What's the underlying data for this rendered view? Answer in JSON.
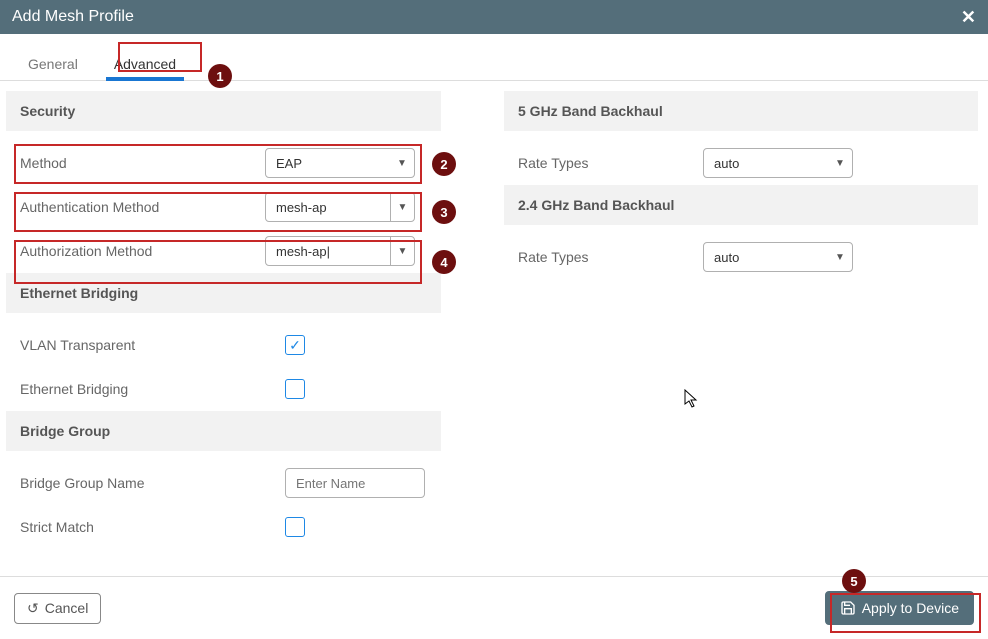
{
  "titlebar": {
    "title": "Add Mesh Profile"
  },
  "tabs": {
    "general": "General",
    "advanced": "Advanced"
  },
  "security": {
    "heading": "Security",
    "method_label": "Method",
    "method_value": "EAP",
    "auth_label": "Authentication Method",
    "auth_value": "mesh-ap",
    "authz_label": "Authorization Method",
    "authz_value": "mesh-ap|"
  },
  "ethernet": {
    "heading": "Ethernet Bridging",
    "vlan_label": "VLAN Transparent",
    "vlan_checked": true,
    "bridge_label": "Ethernet Bridging",
    "bridge_checked": false
  },
  "bridge_group": {
    "heading": "Bridge Group",
    "name_label": "Bridge Group Name",
    "name_placeholder": "Enter Name",
    "strict_label": "Strict Match",
    "strict_checked": false
  },
  "backhaul5": {
    "heading": "5 GHz Band Backhaul",
    "rate_label": "Rate Types",
    "rate_value": "auto"
  },
  "backhaul24": {
    "heading": "2.4 GHz Band Backhaul",
    "rate_label": "Rate Types",
    "rate_value": "auto"
  },
  "footer": {
    "cancel": "Cancel",
    "apply": "Apply to Device"
  },
  "badges": {
    "b1": "1",
    "b2": "2",
    "b3": "3",
    "b4": "4",
    "b5": "5"
  }
}
